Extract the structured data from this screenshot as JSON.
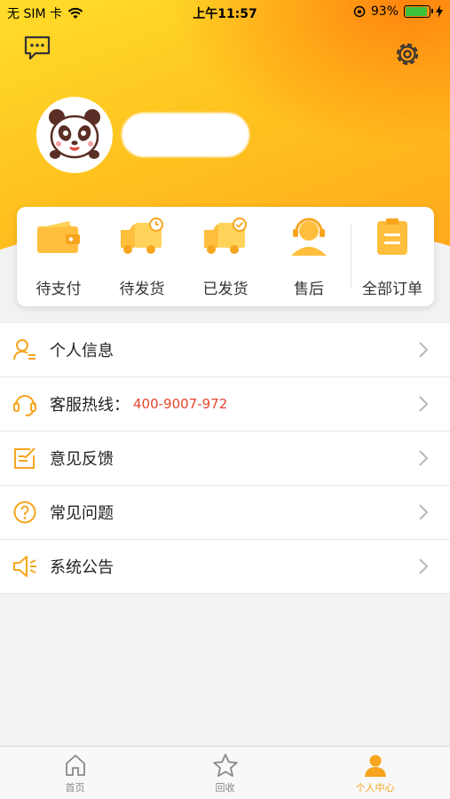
{
  "status_bar": {
    "carrier": "无 SIM 卡",
    "time": "上午11:57",
    "battery_percent": "93%",
    "battery_level": 0.93
  },
  "header": {
    "message_icon": "chat-bubble-icon",
    "settings_icon": "gear-icon",
    "avatar_icon": "panda-avatar"
  },
  "orders": [
    {
      "label": "待支付",
      "icon": "wallet-icon"
    },
    {
      "label": "待发货",
      "icon": "truck-clock-icon"
    },
    {
      "label": "已发货",
      "icon": "truck-check-icon"
    },
    {
      "label": "售后",
      "icon": "support-agent-icon"
    },
    {
      "label": "全部订单",
      "icon": "clipboard-icon"
    }
  ],
  "menu": [
    {
      "label": "个人信息",
      "icon": "user-profile-icon"
    },
    {
      "label": "客服热线：",
      "value": "400-9007-972",
      "icon": "headset-icon"
    },
    {
      "label": "意见反馈",
      "icon": "feedback-edit-icon"
    },
    {
      "label": "常见问题",
      "icon": "question-icon"
    },
    {
      "label": "系统公告",
      "icon": "speaker-icon"
    }
  ],
  "tabbar": [
    {
      "label": "首页",
      "icon": "home-icon",
      "active": false
    },
    {
      "label": "回收",
      "icon": "star-icon",
      "active": false
    },
    {
      "label": "个人中心",
      "icon": "person-icon",
      "active": true
    }
  ],
  "colors": {
    "accent": "#f7a51e",
    "phone": "#e8442c",
    "header_start": "#ffdd2a",
    "header_end": "#ffa41c"
  }
}
